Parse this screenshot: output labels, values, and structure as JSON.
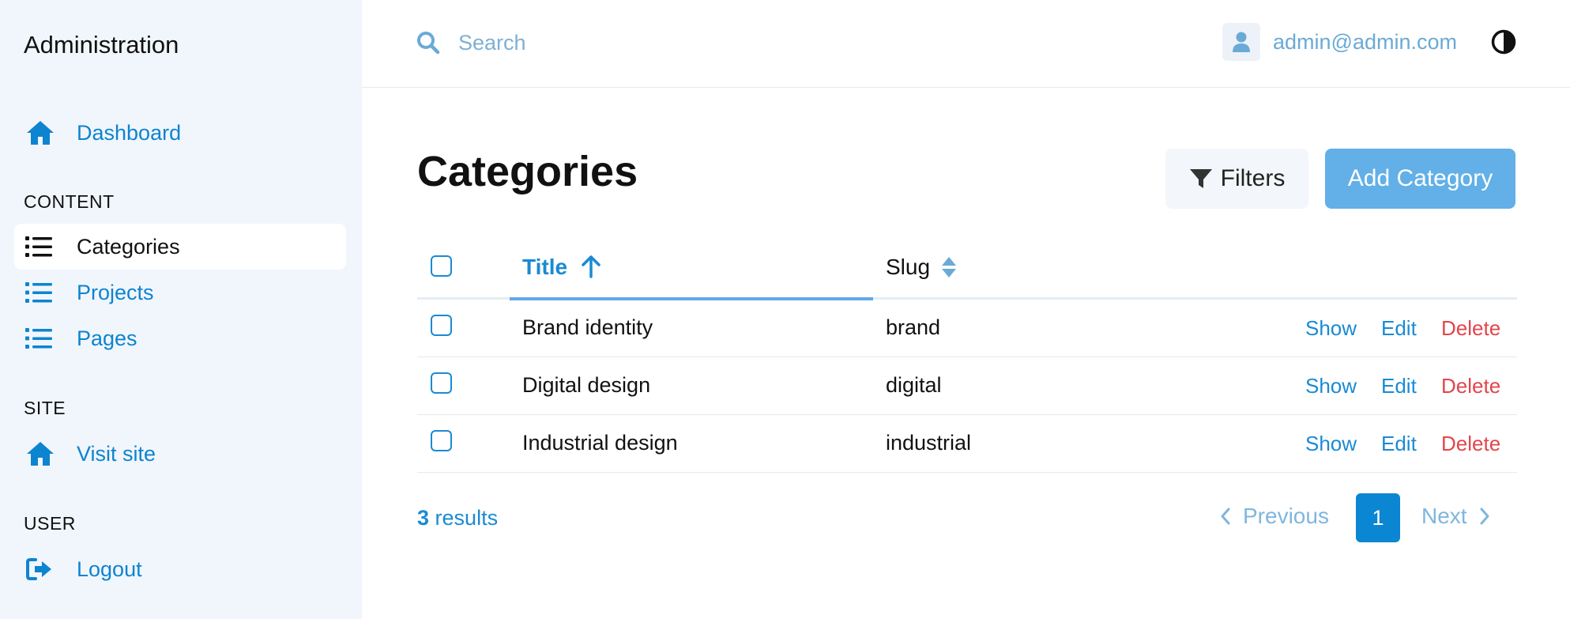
{
  "sidebar": {
    "brand": "Administration",
    "dashboard": "Dashboard",
    "sections": {
      "content": "CONTENT",
      "site": "SITE",
      "user": "USER"
    },
    "content_items": [
      "Categories",
      "Projects",
      "Pages"
    ],
    "visit_site": "Visit site",
    "logout": "Logout"
  },
  "topbar": {
    "search_placeholder": "Search",
    "user_email": "admin@admin.com"
  },
  "main": {
    "title": "Categories",
    "filters_label": "Filters",
    "add_label": "Add Category"
  },
  "table": {
    "columns": {
      "title": "Title",
      "slug": "Slug"
    },
    "rows": [
      {
        "title": "Brand identity",
        "slug": "brand"
      },
      {
        "title": "Digital design",
        "slug": "digital"
      },
      {
        "title": "Industrial design",
        "slug": "industrial"
      }
    ],
    "actions": {
      "show": "Show",
      "edit": "Edit",
      "delete": "Delete"
    }
  },
  "footer": {
    "results_count": "3",
    "results_label": "results",
    "previous": "Previous",
    "current_page": "1",
    "next": "Next"
  },
  "colors": {
    "accent": "#0b86d2",
    "link": "#1a8ad4",
    "danger": "#e2454b",
    "sidebar_bg": "#f1f6fd",
    "primary_button": "#62b0e7"
  }
}
